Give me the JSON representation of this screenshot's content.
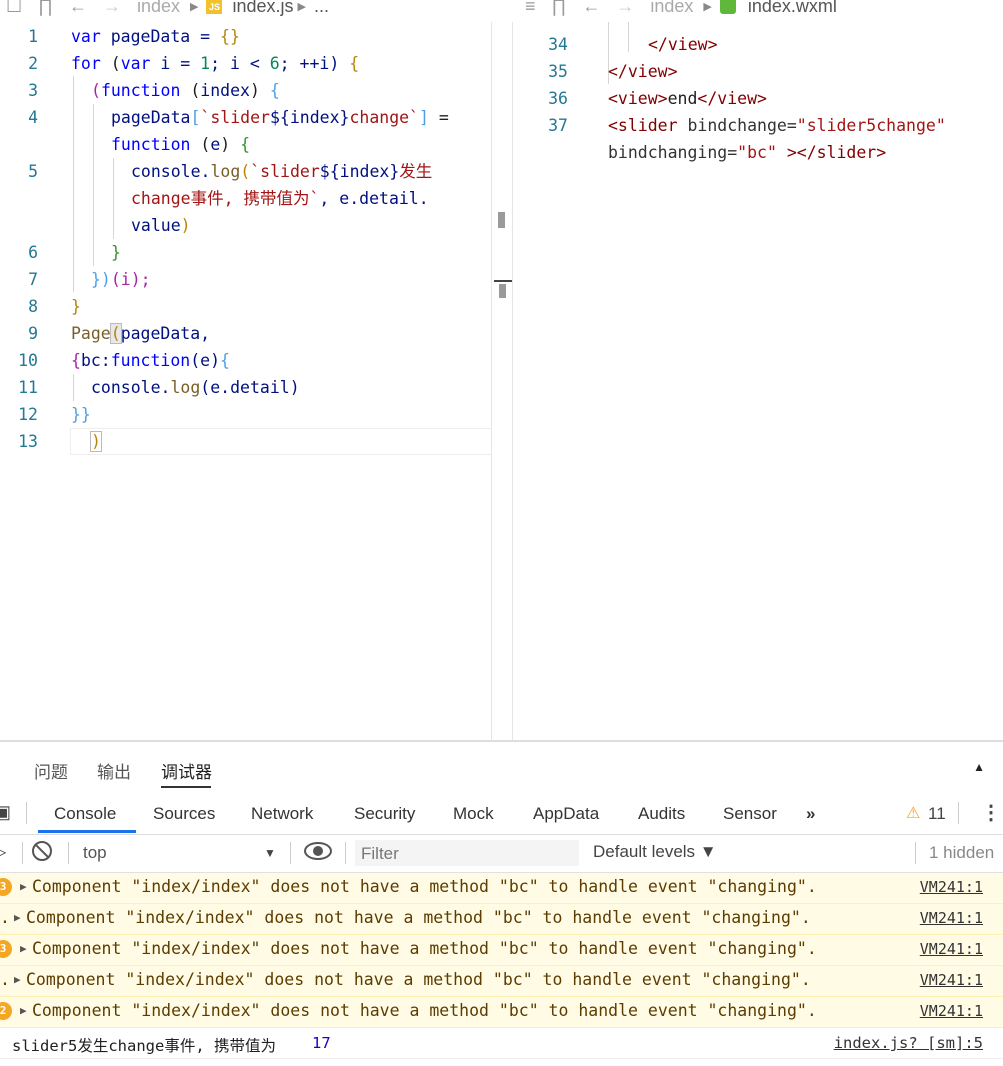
{
  "left_editor": {
    "breadcrumb": {
      "folder": "index",
      "file": "index.js",
      "more": "..."
    },
    "lines": [
      {
        "n": "1"
      },
      {
        "n": "2"
      },
      {
        "n": "3"
      },
      {
        "n": "4"
      },
      {
        "n": "5"
      },
      {
        "n": "6"
      },
      {
        "n": "7"
      },
      {
        "n": "8"
      },
      {
        "n": "9"
      },
      {
        "n": "10"
      },
      {
        "n": "11"
      },
      {
        "n": "12"
      },
      {
        "n": "13"
      }
    ],
    "code": {
      "l1_kw": "var",
      "l1_rest": " pageData = ",
      "l1_br": "{}",
      "l2_kw": "for",
      "l2_a": " (",
      "l2_kw2": "var",
      "l2_b": " i = ",
      "l2_num": "1",
      "l2_c": "; i < ",
      "l2_num2": "6",
      "l2_d": "; ++i) ",
      "l2_br": "{",
      "l3_br": "(",
      "l3_kw": "function",
      "l3_a": " (",
      "l3_var": "index",
      "l3_b": ") ",
      "l3_br2": "{",
      "l4_a": "pageData",
      "l4_br": "[",
      "l4_str1": "`slider",
      "l4_tpl": "${index}",
      "l4_str2": "change`",
      "l4_br2": "]",
      "l4_b": " =",
      "l4b_kw": "function",
      "l4b_a": " (",
      "l4b_var": "e",
      "l4b_b": ") ",
      "l4b_br": "{",
      "l5_a": "console.",
      "l5_fn": "log",
      "l5_br": "(",
      "l5_str1": "`slider",
      "l5_tpl": "${index}",
      "l5_str2": "发生",
      "l5b_str": "change事件, 携带值为`",
      "l5b_a": ", e.detail.",
      "l5c_a": "value",
      "l5c_br": ")",
      "l6_br": "}",
      "l7_br": "})",
      "l7_a": "(i);",
      "l8_br": "}",
      "l9_fn": "Page",
      "l9_br": "(",
      "l9_a": "pageData,",
      "l10_br": "{",
      "l10_a": "bc:",
      "l10_kw": "function",
      "l10_b": "(e)",
      "l10_br2": "{",
      "l11_a": "console.",
      "l11_fn": "log",
      "l11_b": "(e.detail)",
      "l12_br": "}}",
      "l13_br": ")"
    }
  },
  "right_editor": {
    "breadcrumb": {
      "folder": "index",
      "file": "index.wxml"
    },
    "lines": [
      {
        "n": "34",
        "code": "</view>"
      },
      {
        "n": "35",
        "code": "</view>"
      },
      {
        "n": "36",
        "code_a": "<view>",
        "code_b": "end",
        "code_c": "</view>"
      },
      {
        "n": "37",
        "code_a": "<slider",
        "code_b": " bindchange=",
        "code_c": "\"slider5change\"",
        "code_d": "bindchanging=",
        "code_e": "\"bc\"",
        "code_f": " ></slider>"
      }
    ]
  },
  "panel": {
    "tabs": [
      "问题",
      "输出",
      "调试器"
    ],
    "active_tab": "调试器",
    "devtools_tabs": [
      "Console",
      "Sources",
      "Network",
      "Security",
      "Mock",
      "AppData",
      "Audits",
      "Sensor"
    ],
    "active_devtools_tab": "Console",
    "more_tabs": "»",
    "warning_count": "11",
    "context": "top",
    "filter_placeholder": "Filter",
    "levels": "Default levels ▼",
    "hidden": "1 hidden",
    "messages": [
      {
        "badge": "3",
        "text": "Component \"index/index\" does not have a method \"bc\" to handle event \"changing\".",
        "src": "VM241:1"
      },
      {
        "badge": "",
        "text": "Component \"index/index\" does not have a method \"bc\" to handle event \"changing\".",
        "src": "VM241:1"
      },
      {
        "badge": "3",
        "text": "Component \"index/index\" does not have a method \"bc\" to handle event \"changing\".",
        "src": "VM241:1"
      },
      {
        "badge": "",
        "text": "Component \"index/index\" does not have a method \"bc\" to handle event \"changing\".",
        "src": "VM241:1"
      },
      {
        "badge": "2",
        "text": "Component \"index/index\" does not have a method \"bc\" to handle event \"changing\".",
        "src": "VM241:1"
      }
    ],
    "log": {
      "text": "slider5发生change事件, 携带值为",
      "value": "17",
      "src": "index.js? [sm]:5"
    }
  }
}
